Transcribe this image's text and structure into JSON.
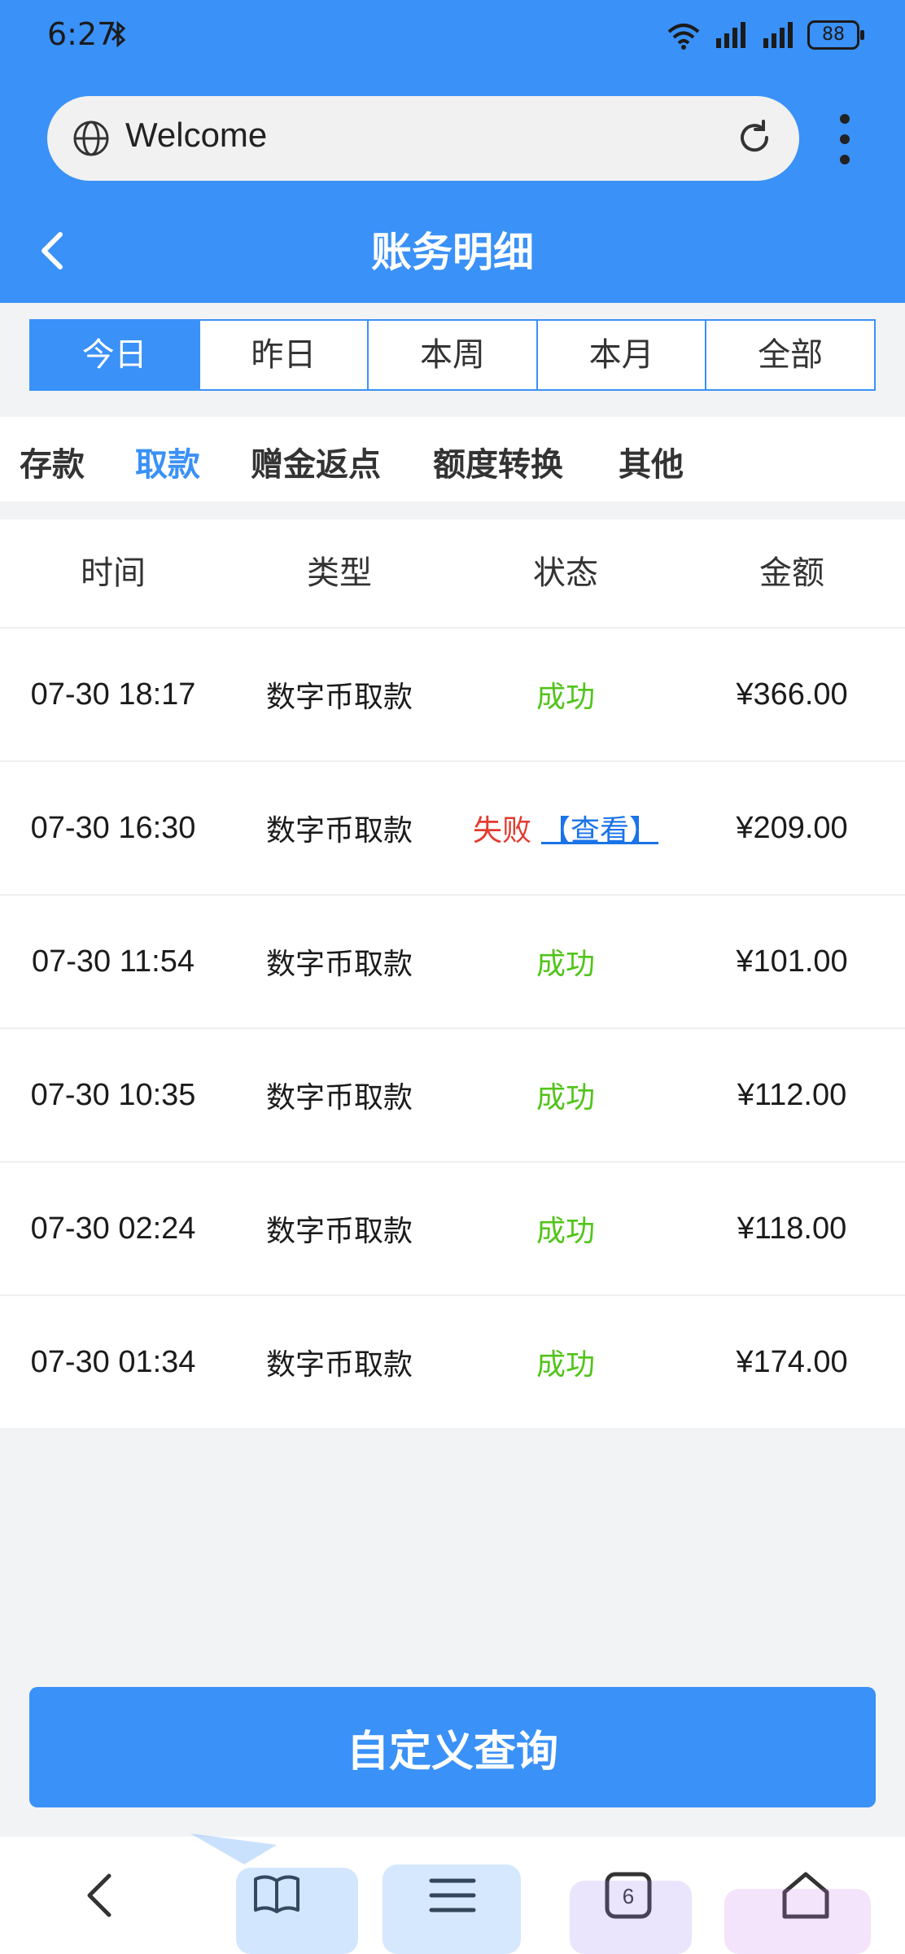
{
  "status_bar": {
    "time": "6:27",
    "battery": "88"
  },
  "browser": {
    "url_title": "Welcome",
    "tab_count": "6"
  },
  "header": {
    "title": "账务明细"
  },
  "periods": [
    "今日",
    "昨日",
    "本周",
    "本月",
    "全部"
  ],
  "categories": [
    "存款",
    "取款",
    "赠金返点",
    "额度转换",
    "其他"
  ],
  "table": {
    "headers": [
      "时间",
      "类型",
      "状态",
      "金额"
    ],
    "rows": [
      {
        "time": "07-30 18:17",
        "type": "数字币取款",
        "status": "成功",
        "amount": "¥366.00"
      },
      {
        "time": "07-30 16:30",
        "type": "数字币取款",
        "status": "失败",
        "view": "【查看】",
        "amount": "¥209.00"
      },
      {
        "time": "07-30 11:54",
        "type": "数字币取款",
        "status": "成功",
        "amount": "¥101.00"
      },
      {
        "time": "07-30 10:35",
        "type": "数字币取款",
        "status": "成功",
        "amount": "¥112.00"
      },
      {
        "time": "07-30 02:24",
        "type": "数字币取款",
        "status": "成功",
        "amount": "¥118.00"
      },
      {
        "time": "07-30 01:34",
        "type": "数字币取款",
        "status": "成功",
        "amount": "¥174.00"
      }
    ]
  },
  "query_button": "自定义查询",
  "colors": {
    "primary": "#3a91f7",
    "success": "#52c41a",
    "fail": "#e43a2f",
    "link": "#1a73e8"
  },
  "icons": [
    "bluetooth-icon",
    "wifi-icon",
    "signal-icon",
    "globe-icon",
    "reload-icon",
    "more-icon",
    "back-icon",
    "bookmarks-icon",
    "menu-icon",
    "tabs-icon",
    "home-icon"
  ]
}
